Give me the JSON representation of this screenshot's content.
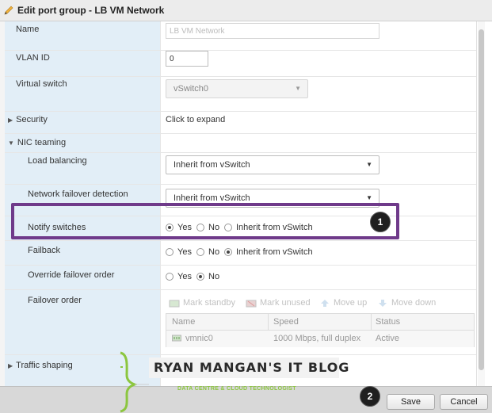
{
  "window": {
    "title": "Edit port group - LB VM Network"
  },
  "fields": {
    "name": {
      "label": "Name",
      "placeholder": "LB VM Network"
    },
    "vlan": {
      "label": "VLAN ID",
      "value": "0"
    },
    "vswitch": {
      "label": "Virtual switch",
      "value": "vSwitch0"
    },
    "security": {
      "label": "Security",
      "value": "Click to expand"
    },
    "nic_teaming": {
      "label": "NIC teaming"
    },
    "load_balancing": {
      "label": "Load balancing",
      "value": "Inherit from vSwitch"
    },
    "failover_detection": {
      "label": "Network failover detection",
      "value": "Inherit from vSwitch"
    },
    "notify_switches": {
      "label": "Notify switches",
      "options": [
        "Yes",
        "No",
        "Inherit from vSwitch"
      ],
      "selected": "Yes"
    },
    "failback": {
      "label": "Failback",
      "options": [
        "Yes",
        "No",
        "Inherit from vSwitch"
      ],
      "selected": "Inherit from vSwitch"
    },
    "override_failover": {
      "label": "Override failover order",
      "options": [
        "Yes",
        "No"
      ],
      "selected": "No"
    },
    "failover_order": {
      "label": "Failover order",
      "toolbar": [
        "Mark standby",
        "Mark unused",
        "Move up",
        "Move down"
      ],
      "columns": [
        "Name",
        "Speed",
        "Status"
      ],
      "rows": [
        {
          "name": "vmnic0",
          "speed": "1000 Mbps, full duplex",
          "status": "Active"
        }
      ]
    },
    "traffic_shaping": {
      "label": "Traffic shaping"
    }
  },
  "annotations": {
    "badge1": "1",
    "badge2": "2"
  },
  "buttons": {
    "save": "Save",
    "cancel": "Cancel"
  },
  "watermark": {
    "title": "RYAN MANGAN'S IT BLOG",
    "subtitle": "DATA CENTRE & CLOUD TECHNOLOGIST"
  },
  "colors": {
    "label_bg": "#e2eef7",
    "callout": "#6f3a8a",
    "footer_bg": "#d8d8d8",
    "brand_green": "#8cc63f"
  }
}
